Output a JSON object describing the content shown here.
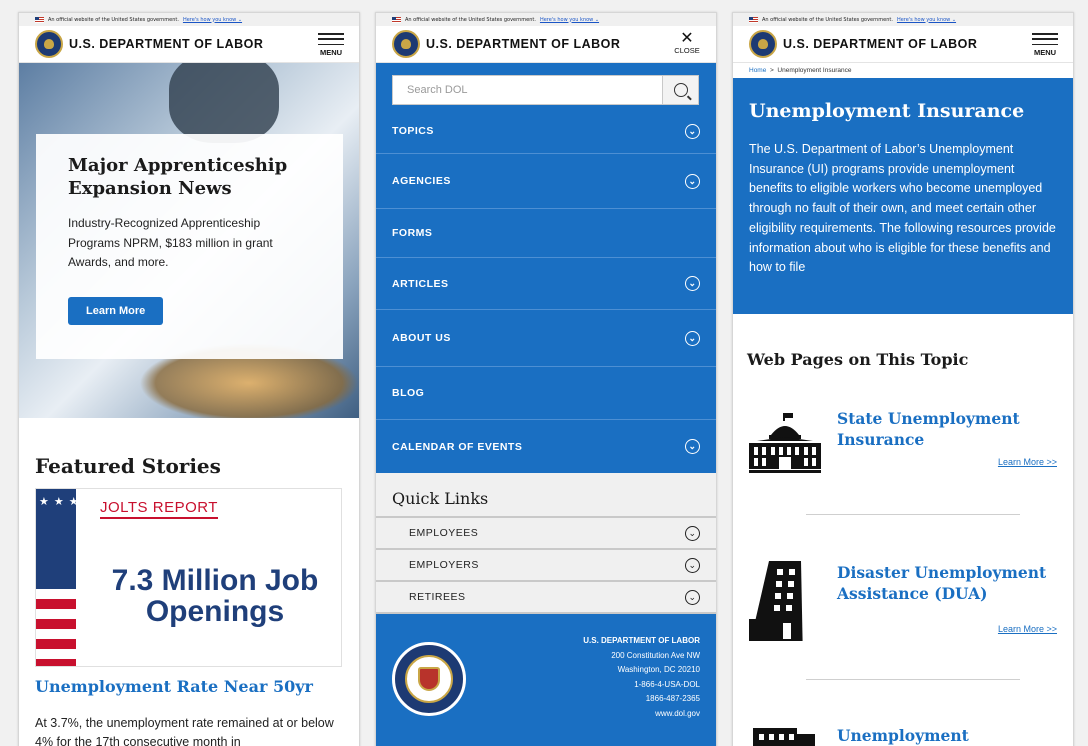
{
  "gov_banner": {
    "text": "An official website of the United States government.",
    "link": "Here's how you know ⌄"
  },
  "header": {
    "title": "U.S. DEPARTMENT OF LABOR",
    "menu_label": "MENU",
    "close_label": "CLOSE"
  },
  "home": {
    "hero": {
      "title": "Major Apprenticeship Expansion News",
      "body": "Industry-Recognized Apprenticeship Programs NPRM, $183 million in grant Awards, and more.",
      "button": "Learn More"
    },
    "featured": {
      "heading": "Featured Stories",
      "image_tag": "JOLTS REPORT",
      "image_headline": "7.3 Million Job Openings",
      "story_title": "Unemployment Rate Near 50yr",
      "story_text": "At 3.7%, the unemployment rate remained at or below 4% for the 17th consecutive month in"
    }
  },
  "menu": {
    "search_placeholder": "Search DOL",
    "items": [
      {
        "label": "TOPICS"
      },
      {
        "label": "AGENCIES"
      },
      {
        "label": "FORMS"
      },
      {
        "label": "ARTICLES"
      },
      {
        "label": "ABOUT US"
      },
      {
        "label": "BLOG"
      },
      {
        "label": "CALENDAR OF EVENTS"
      }
    ],
    "quick_links": {
      "heading": "Quick Links",
      "items": [
        {
          "label": "EMPLOYEES"
        },
        {
          "label": "EMPLOYERS"
        },
        {
          "label": "RETIREES"
        }
      ]
    },
    "footer": {
      "org": "U.S. DEPARTMENT OF LABOR",
      "street": "200 Constitution Ave NW",
      "city": "Washington, DC 20210",
      "phone1": "1-866-4-USA-DOL",
      "phone2": "1866-487-2365",
      "web": "www.dol.gov"
    }
  },
  "unemployment": {
    "breadcrumb": {
      "home": "Home",
      "sep": ">",
      "current": "Unemployment Insurance"
    },
    "title": "Unemployment Insurance",
    "description": "The U.S. Department of Labor’s Unemployment Insurance (UI) programs provide unemployment benefits to eligible workers who become unemployed through no fault of their own, and meet certain other eligibility requirements. The following resources provide information about who is eligible for these benefits and how to file",
    "web_pages_heading": "Web Pages on This Topic",
    "topics": [
      {
        "name": "State Unemployment Insurance",
        "more": "Learn More >>",
        "icon": "capitol-building-icon"
      },
      {
        "name": "Disaster Unemployment Assistance (DUA)",
        "more": "Learn More >>",
        "icon": "damaged-building-icon"
      },
      {
        "name": "Unemployment",
        "icon": "building-icon"
      }
    ]
  },
  "colors": {
    "brand_blue": "#1a6fc2",
    "dark_text": "#1b1b1b",
    "nav_divider": "#4d8fd3"
  }
}
